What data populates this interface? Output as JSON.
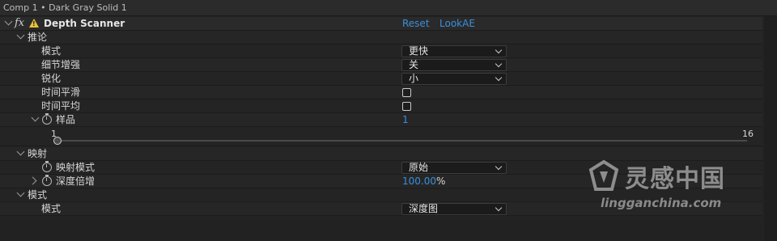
{
  "header": {
    "title": "Comp 1 • Dark Gray Solid 1"
  },
  "effect": {
    "fx_label": "fx",
    "warning_glyph": "!",
    "name": "Depth Scanner",
    "reset_label": "Reset",
    "lookae_label": "LookAE"
  },
  "groups": {
    "inference": "推论",
    "mapping": "映射",
    "mode": "模式"
  },
  "params": {
    "mode": {
      "label": "模式",
      "value": "更快"
    },
    "detail": {
      "label": "细节增强",
      "value": "关"
    },
    "sharpen": {
      "label": "锐化",
      "value": "小"
    },
    "temporal_smooth": {
      "label": "时间平滑",
      "checked": false
    },
    "temporal_avg": {
      "label": "时间平均",
      "checked": false
    },
    "samples": {
      "label": "样品",
      "value": "1",
      "slider_min": "1",
      "slider_max": "16",
      "slider_value": 1
    },
    "mapping_mode": {
      "label": "映射模式",
      "value": "原始"
    },
    "depth_mult": {
      "label": "深度倍增",
      "value": "100.00",
      "unit": "%"
    },
    "out_mode": {
      "label": "模式",
      "value": "深度图"
    }
  },
  "watermark": {
    "title": "灵感中国",
    "subtitle": "lingganchina.com"
  },
  "colors": {
    "accent": "#3a8fdc",
    "warning": "#e8c23a",
    "background": "#232323"
  }
}
